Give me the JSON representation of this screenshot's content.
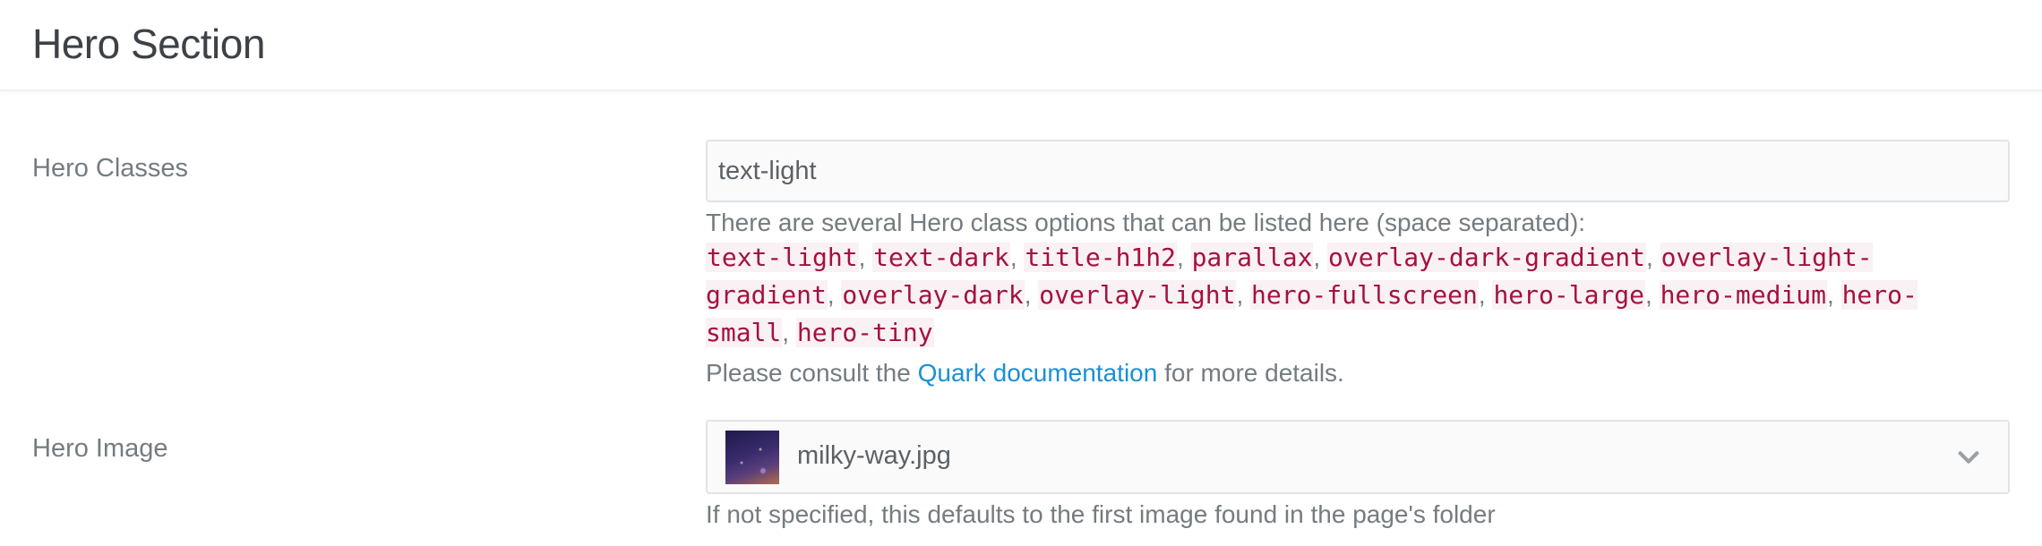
{
  "section": {
    "title": "Hero Section"
  },
  "hero_classes": {
    "label": "Hero Classes",
    "value": "text-light",
    "help_intro": "There are several Hero class options that can be listed here (space separated):",
    "options": [
      "text-light",
      "text-dark",
      "title-h1h2",
      "parallax",
      "overlay-dark-gradient",
      "overlay-light-gradient",
      "overlay-dark",
      "overlay-light",
      "hero-fullscreen",
      "hero-large",
      "hero-medium",
      "hero-small",
      "hero-tiny"
    ],
    "separator": ",",
    "consult_prefix": "Please consult the",
    "link_text": "Quark documentation",
    "consult_suffix": "for more details."
  },
  "hero_image": {
    "label": "Hero Image",
    "selected_file": "milky-way.jpg",
    "help": "If not specified, this defaults to the first image found in the page's folder",
    "chevron_icon": "chevron-down-icon"
  }
}
